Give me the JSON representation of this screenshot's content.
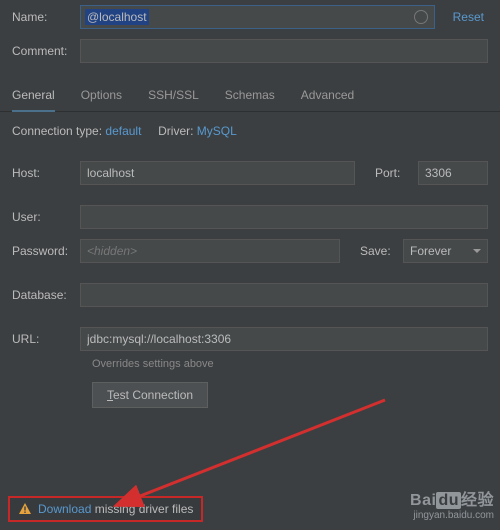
{
  "header": {
    "name_label": "Name:",
    "name_value": "@localhost",
    "reset": "Reset",
    "comment_label": "Comment:",
    "comment_value": ""
  },
  "tabs": [
    "General",
    "Options",
    "SSH/SSL",
    "Schemas",
    "Advanced"
  ],
  "active_tab": 0,
  "connection": {
    "type_label": "Connection type:",
    "type_value": "default",
    "driver_label": "Driver:",
    "driver_value": "MySQL"
  },
  "fields": {
    "host_label": "Host:",
    "host_value": "localhost",
    "port_label": "Port:",
    "port_value": "3306",
    "user_label": "User:",
    "user_value": "",
    "password_label": "Password:",
    "password_placeholder": "<hidden>",
    "save_label": "Save:",
    "save_value": "Forever",
    "database_label": "Database:",
    "database_value": "",
    "url_label": "URL:",
    "url_value": "jdbc:mysql://localhost:3306",
    "url_hint": "Overrides settings above",
    "test_button": "Test Connection"
  },
  "footer": {
    "download": "Download",
    "missing": " missing driver files"
  },
  "watermark": {
    "brand_a": "Bai",
    "brand_b": "du",
    "brand_c": "经验",
    "url": "jingyan.baidu.com"
  }
}
